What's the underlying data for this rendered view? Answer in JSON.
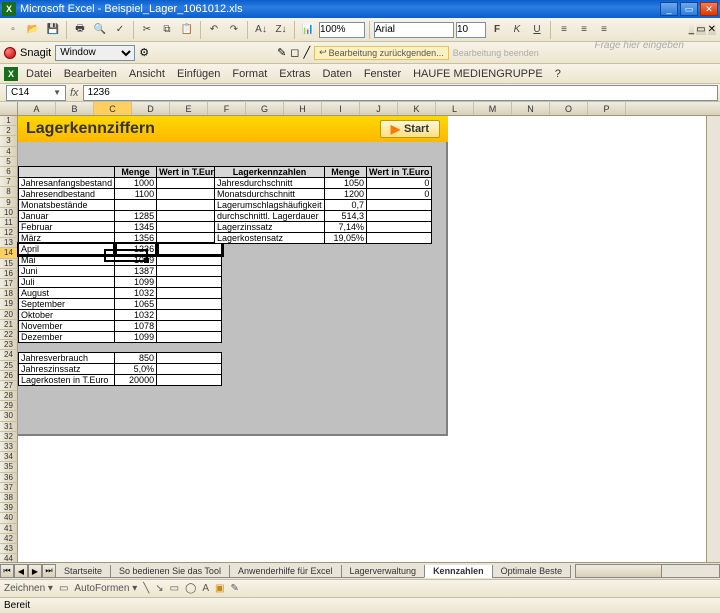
{
  "window": {
    "app": "Microsoft Excel",
    "file": "Beispiel_Lager_1061012.xls"
  },
  "menu": [
    "Datei",
    "Bearbeiten",
    "Ansicht",
    "Einfügen",
    "Format",
    "Extras",
    "Daten",
    "Fenster",
    "HAUFE MEDIENGRUPPE",
    "?"
  ],
  "toolbar": {
    "zoom": "100%",
    "font": "Arial",
    "fontsize": "10",
    "help_placeholder": "Frage hier eingeben"
  },
  "snagit": {
    "label": "Snagit",
    "profile": "Window"
  },
  "edit_notice": {
    "text1": "Bearbeitung zurückgenden...",
    "text2": "Bearbeitung beenden"
  },
  "formula": {
    "cell": "C14",
    "value": "1236"
  },
  "columns": [
    "A",
    "B",
    "C",
    "D",
    "E",
    "F",
    "G",
    "H",
    "I",
    "J",
    "K",
    "L",
    "M",
    "N",
    "O",
    "P"
  ],
  "panel": {
    "title": "Lagerkennziffern",
    "start": "Start"
  },
  "left_table": {
    "headers": [
      "",
      "Menge",
      "Wert in T.Euro"
    ],
    "rows": [
      {
        "label": "Jahresanfangsbestand",
        "m": "1000",
        "w": ""
      },
      {
        "label": "Jahresendbestand",
        "m": "1100",
        "w": ""
      },
      {
        "label": "Monatsbestände",
        "m": "",
        "w": "",
        "section": true
      },
      {
        "label": "Januar",
        "m": "1285",
        "w": ""
      },
      {
        "label": "Februar",
        "m": "1345",
        "w": ""
      },
      {
        "label": "März",
        "m": "1356",
        "w": ""
      },
      {
        "label": "April",
        "m": "1236",
        "w": "",
        "active": true
      },
      {
        "label": "Mai",
        "m": "1089",
        "w": ""
      },
      {
        "label": "Juni",
        "m": "1387",
        "w": ""
      },
      {
        "label": "Juli",
        "m": "1099",
        "w": ""
      },
      {
        "label": "August",
        "m": "1032",
        "w": ""
      },
      {
        "label": "September",
        "m": "1065",
        "w": ""
      },
      {
        "label": "Oktober",
        "m": "1032",
        "w": ""
      },
      {
        "label": "November",
        "m": "1078",
        "w": ""
      },
      {
        "label": "Dezember",
        "m": "1099",
        "w": ""
      }
    ],
    "gap": true,
    "footer": [
      {
        "label": "Jahresverbrauch",
        "m": "850",
        "w": ""
      },
      {
        "label": "Jahreszinssatz",
        "m": "5,0%",
        "w": ""
      },
      {
        "label": "Lagerkosten in T.Euro",
        "m": "20000",
        "w": ""
      }
    ]
  },
  "right_table": {
    "headers": [
      "Lagerkennzahlen",
      "Menge",
      "Wert in T.Euro"
    ],
    "rows": [
      {
        "label": "Jahresdurchschnitt",
        "m": "1050",
        "w": "0"
      },
      {
        "label": "Monatsdurchschnitt",
        "m": "1200",
        "w": "0"
      },
      {
        "label": "Lagerumschlagshäufigkeit",
        "m": "0,7",
        "w": ""
      },
      {
        "label": "durchschnittl. Lagerdauer",
        "m": "514,3",
        "w": ""
      },
      {
        "label": "Lagerzinssatz",
        "m": "7,14%",
        "w": ""
      },
      {
        "label": "Lagerkostensatz",
        "m": "19,05%",
        "w": ""
      }
    ]
  },
  "tabs": {
    "items": [
      "Startseite",
      "So bedienen Sie das Tool",
      "Anwenderhilfe für Excel",
      "Lagerverwaltung",
      "Kennzahlen",
      "Optimale Beste"
    ],
    "active": 4
  },
  "draw": {
    "label": "Zeichnen",
    "autoshapes": "AutoFormen"
  },
  "status": {
    "ready": "Bereit"
  }
}
